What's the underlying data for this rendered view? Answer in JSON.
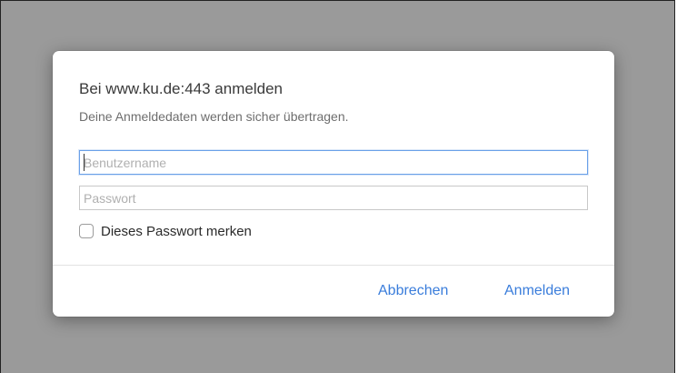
{
  "dialog": {
    "title": "Bei www.ku.de:443 anmelden",
    "subtitle": "Deine Anmeldedaten werden sicher übertragen.",
    "username": {
      "placeholder": "Benutzername",
      "value": ""
    },
    "password": {
      "placeholder": "Passwort",
      "value": ""
    },
    "remember": {
      "label": "Dieses Passwort merken",
      "checked": false
    },
    "buttons": {
      "cancel": "Abbrechen",
      "login": "Anmelden"
    }
  },
  "colors": {
    "backdrop": "#9a9a9a",
    "accent": "#3a7ddb",
    "focus_ring": "#6aa0e8"
  }
}
